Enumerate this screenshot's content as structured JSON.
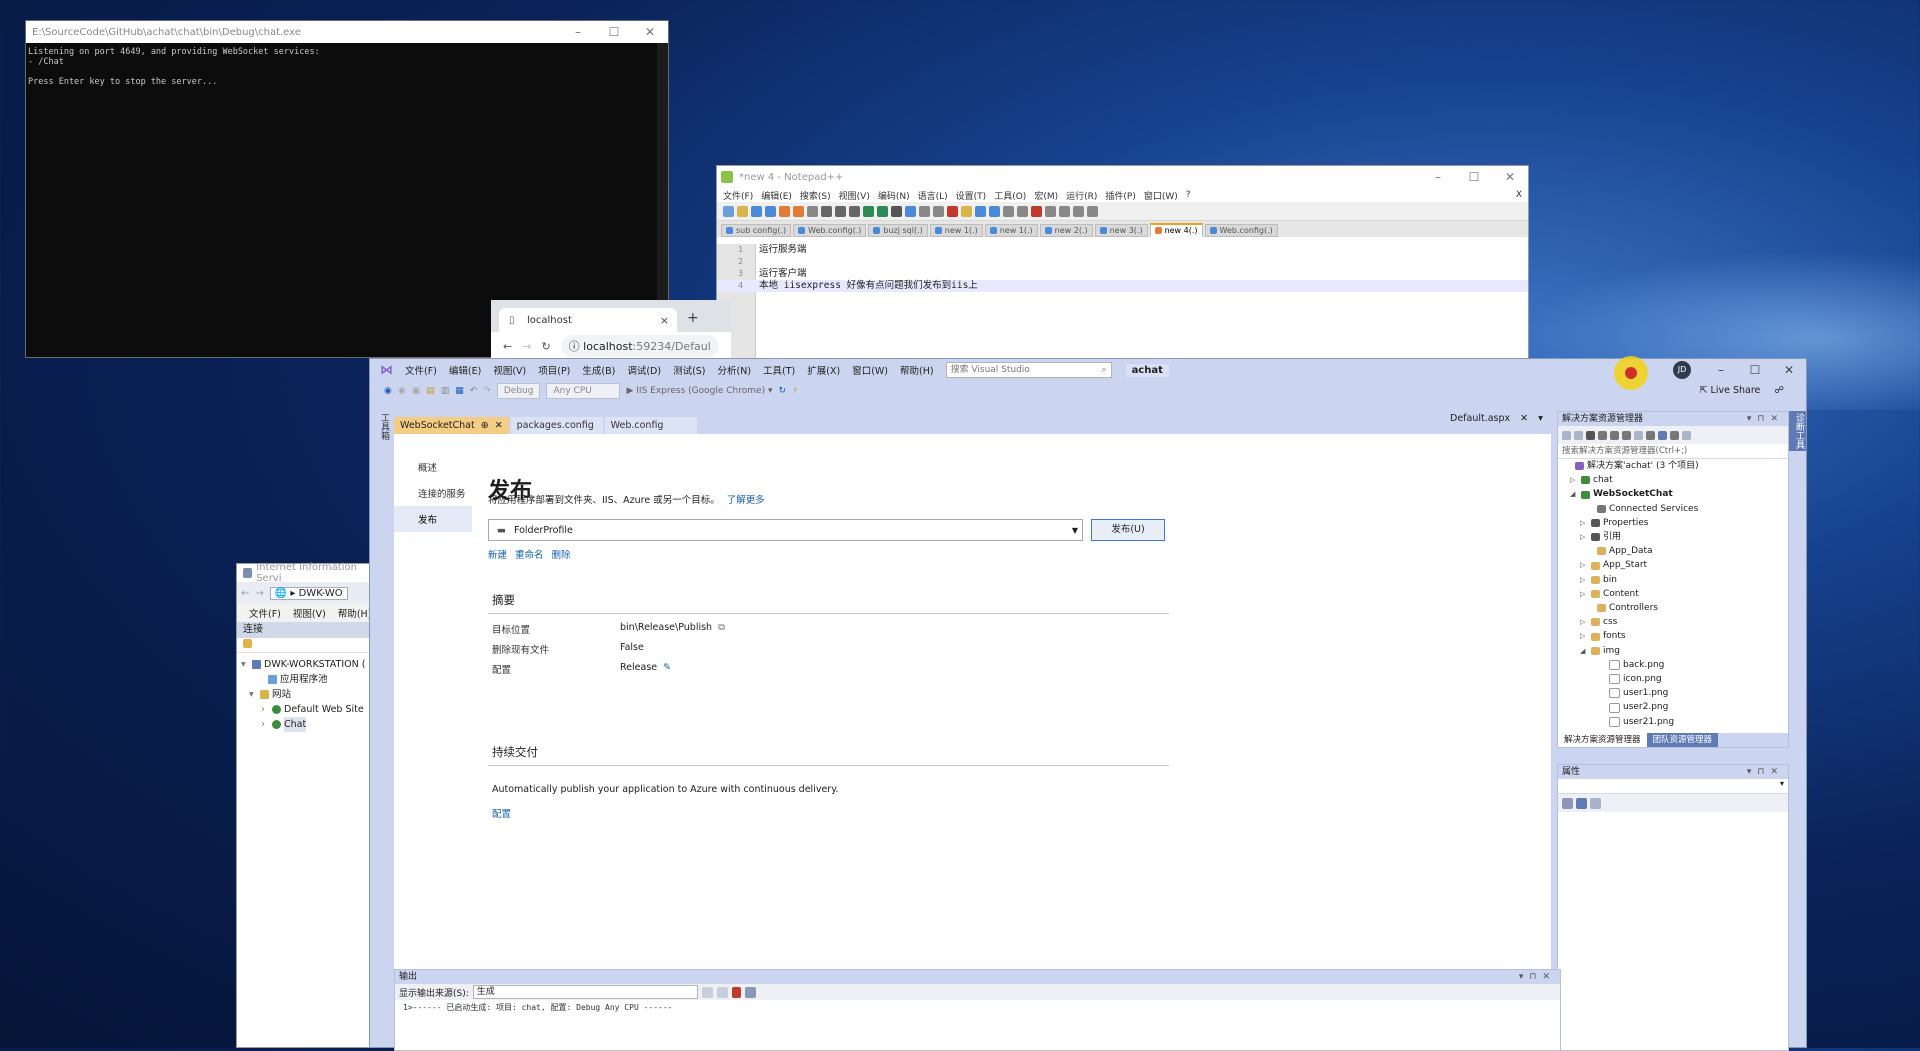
{
  "console": {
    "title": "E:\\SourceCode\\GitHub\\achat\\chat\\bin\\Debug\\chat.exe",
    "lines": "Listening on port 4649, and providing WebSocket services:\n- /Chat\n\nPress Enter key to stop the server..."
  },
  "notepad": {
    "title": "*new 4 - Notepad++",
    "menu": [
      "文件(F)",
      "编辑(E)",
      "搜索(S)",
      "视图(V)",
      "编码(N)",
      "语言(L)",
      "设置(T)",
      "工具(O)",
      "宏(M)",
      "运行(R)",
      "插件(P)",
      "窗口(W)",
      "?"
    ],
    "close_x": "X",
    "tabs": [
      "sub config(.)",
      "Web.config(.)",
      "buzj sql(.)",
      "new 1(.)",
      "new 1(.)",
      "new 2(.)",
      "new 3(.)",
      "new 4(.)",
      "Web.config(.)"
    ],
    "active_tab_index": 7,
    "lines": [
      {
        "num": "1",
        "text": "运行服务端"
      },
      {
        "num": "2",
        "text": ""
      },
      {
        "num": "3",
        "text": "运行客户端"
      },
      {
        "num": "4",
        "text": "本地 iisexpress 好像有点问题我们发布到iis上"
      }
    ]
  },
  "browser": {
    "tab_title": "localhost",
    "tab_close": "×",
    "new_tab": "+",
    "url_host": "localhost",
    "url_rest": ":59234/Defaul"
  },
  "iis": {
    "title": "Internet Information Servi",
    "address": "DWK-WO",
    "menu": [
      "文件(F)",
      "视图(V)",
      "帮助(H)"
    ],
    "connections_label": "连接",
    "tree": [
      "DWK-WORKSTATION (",
      "应用程序池",
      "网站",
      "Default Web Site",
      "Chat"
    ]
  },
  "vs": {
    "menu": [
      "文件(F)",
      "编辑(E)",
      "视图(V)",
      "项目(P)",
      "生成(B)",
      "调试(D)",
      "测试(S)",
      "分析(N)",
      "工具(T)",
      "扩展(X)",
      "窗口(W)",
      "帮助(H)"
    ],
    "search_placeholder": "搜索 Visual Studio",
    "solution_name": "achat",
    "avatar_initials": "JD",
    "live_share": "Live Share",
    "toolbar": {
      "config": "Debug",
      "platform": "Any CPU",
      "run": "IIS Express (Google Chrome)"
    },
    "doc_tabs": [
      {
        "label": "WebSocketChat",
        "active": true
      },
      {
        "label": "packages.config",
        "active": false
      },
      {
        "label": "Web.config",
        "active": false
      }
    ],
    "right_doc_tab": "Default.aspx",
    "left_strip": "工具箱",
    "right_strip": "诊断工具",
    "publish": {
      "nav": [
        "概述",
        "连接的服务",
        "发布"
      ],
      "nav_selected_index": 2,
      "heading": "发布",
      "description": "将应用程序部署到文件夹、IIS、Azure 或另一个目标。",
      "learn_more": "了解更多",
      "profile": "FolderProfile",
      "publish_button": "发布(U)",
      "actions": [
        "新建",
        "重命名",
        "删除"
      ],
      "summary_heading": "摘要",
      "summary": [
        {
          "key": "目标位置",
          "value": "bin\\Release\\Publish"
        },
        {
          "key": "删除现有文件",
          "value": "False"
        },
        {
          "key": "配置",
          "value": "Release"
        }
      ],
      "cd_heading": "持续交付",
      "cd_text": "Automatically publish your application to Azure with continuous delivery.",
      "cd_link": "配置"
    },
    "solution_explorer": {
      "title": "解决方案资源管理器",
      "search_placeholder": "搜索解决方案资源管理器(Ctrl+;)",
      "items": [
        {
          "label": "解决方案'achat' (3 个项目)",
          "bold": false
        },
        {
          "label": "chat",
          "bold": false
        },
        {
          "label": "WebSocketChat",
          "bold": true
        },
        {
          "label": "Connected Services",
          "bold": false
        },
        {
          "label": "Properties",
          "bold": false
        },
        {
          "label": "引用",
          "bold": false
        },
        {
          "label": "App_Data",
          "bold": false
        },
        {
          "label": "App_Start",
          "bold": false
        },
        {
          "label": "bin",
          "bold": false
        },
        {
          "label": "Content",
          "bold": false
        },
        {
          "label": "Controllers",
          "bold": false
        },
        {
          "label": "css",
          "bold": false
        },
        {
          "label": "fonts",
          "bold": false
        },
        {
          "label": "img",
          "bold": false
        },
        {
          "label": "back.png",
          "bold": false
        },
        {
          "label": "icon.png",
          "bold": false
        },
        {
          "label": "user1.png",
          "bold": false
        },
        {
          "label": "user2.png",
          "bold": false
        },
        {
          "label": "user21.png",
          "bold": false
        }
      ],
      "footer_tabs": [
        "解决方案资源管理器",
        "团队资源管理器"
      ]
    },
    "properties": {
      "title": "属性"
    },
    "output": {
      "title": "输出",
      "source_label": "显示输出来源(S):",
      "source_value": "生成",
      "text": "1>------ 已启动生成: 项目: chat, 配置: Debug Any CPU ------"
    }
  }
}
